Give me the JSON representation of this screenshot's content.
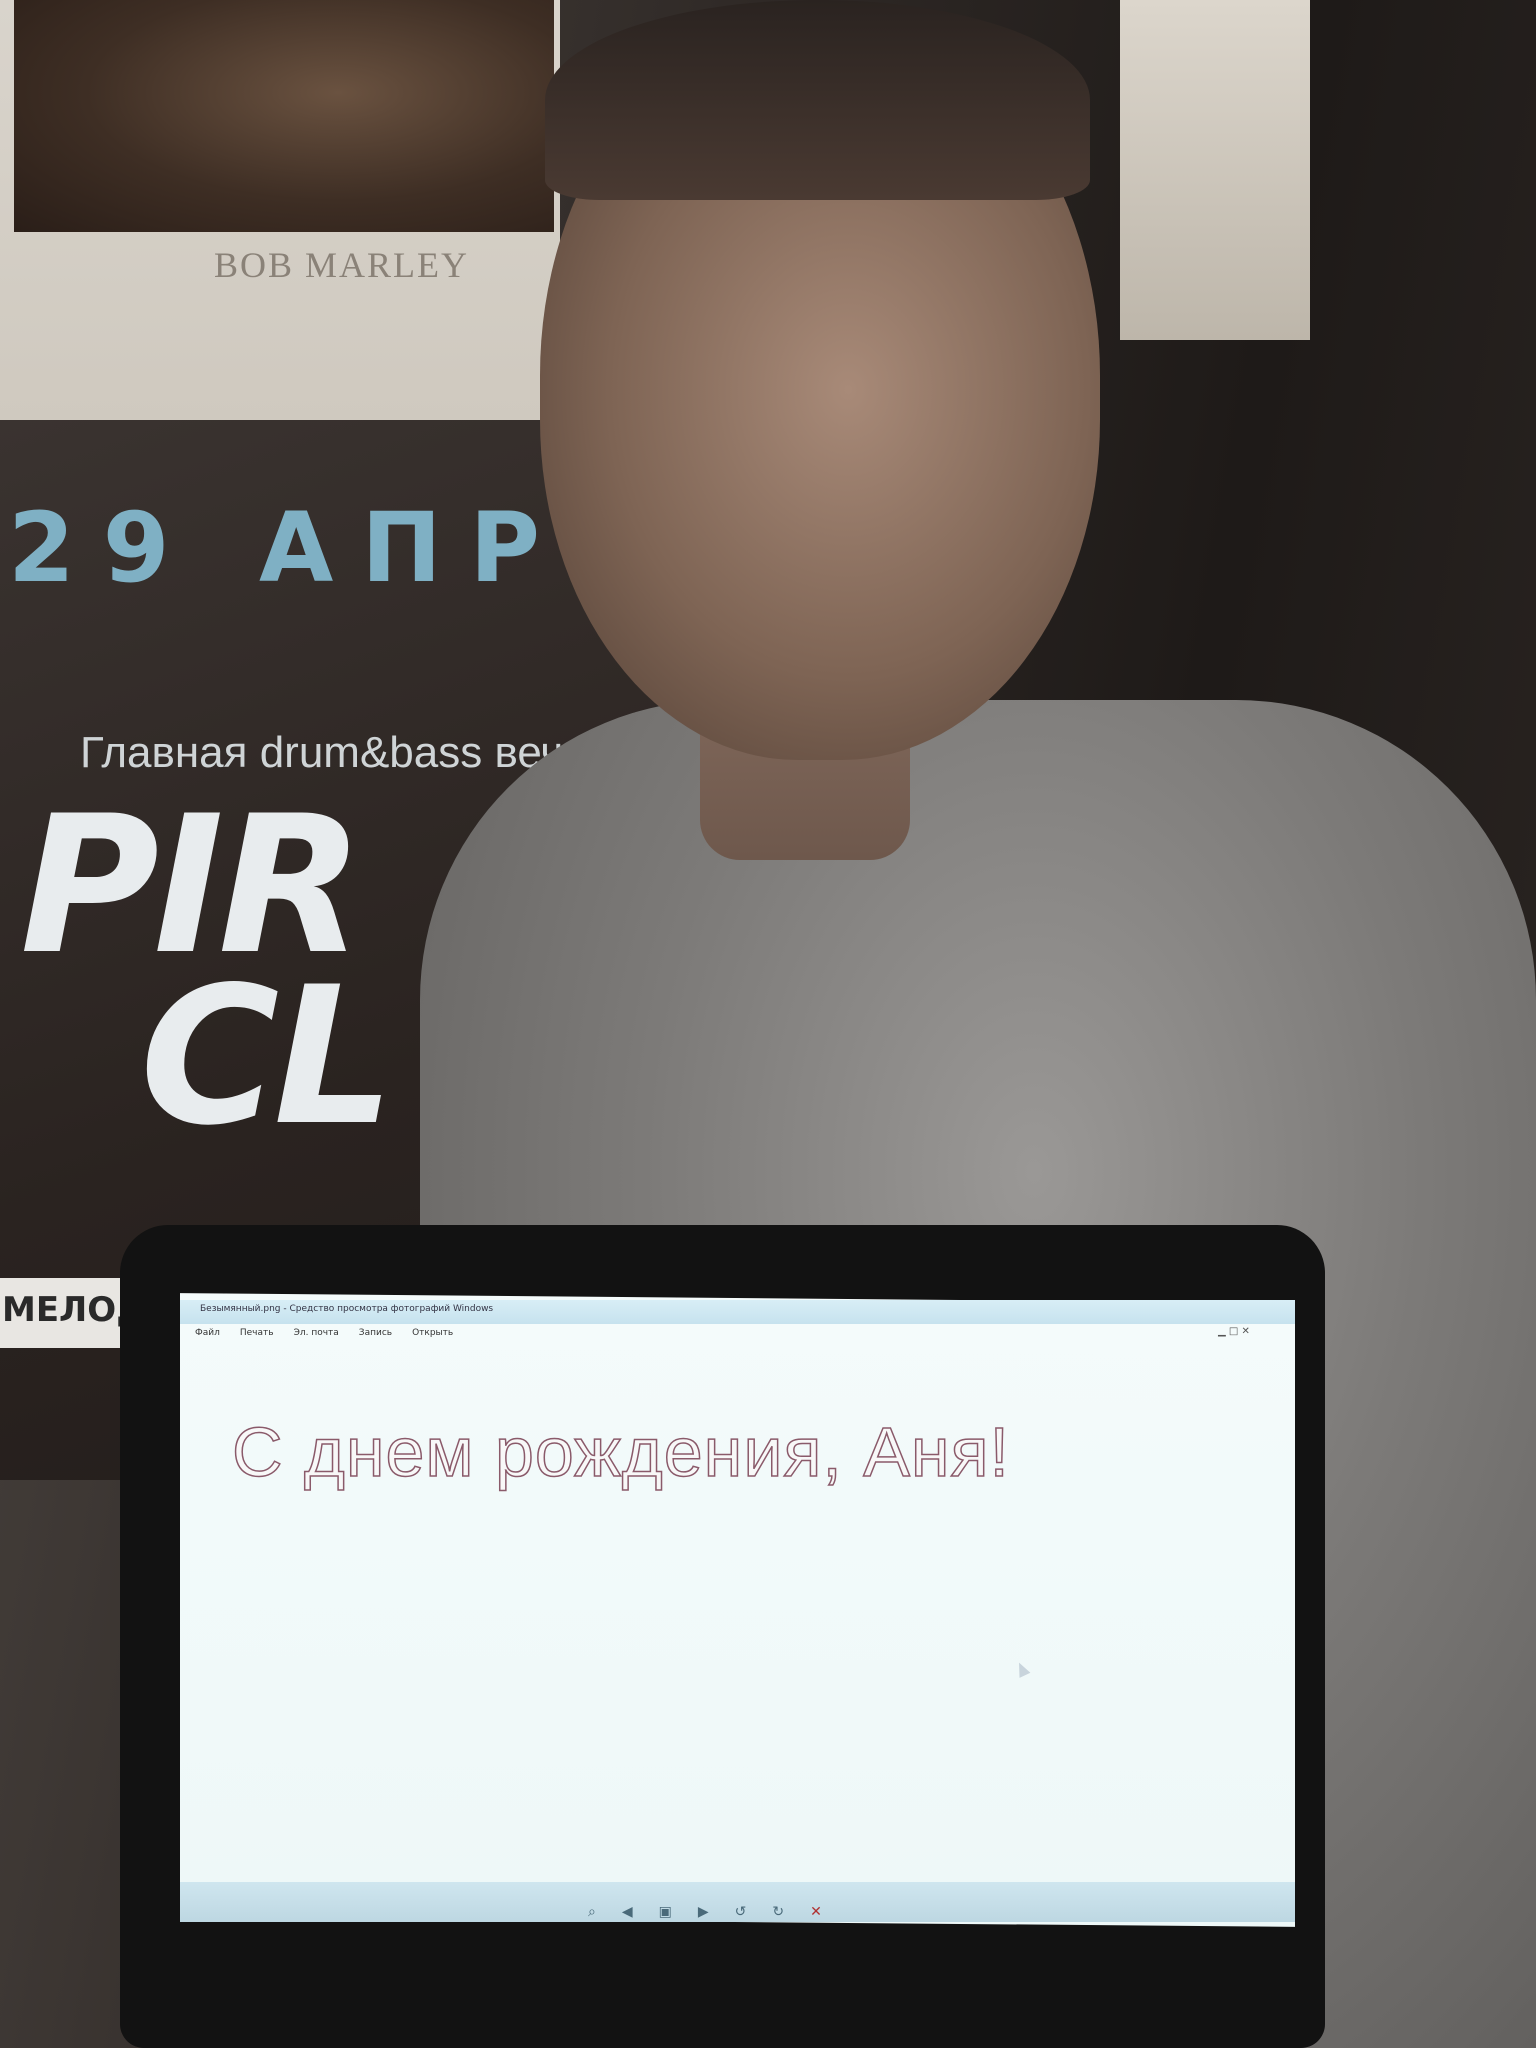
{
  "photo": {
    "poster_top": {
      "artist": "BOB MARLEY"
    },
    "poster_event": {
      "date": "29 АПР",
      "tagline": "Главная drum&bass вечер",
      "logo_line1": "PIR",
      "logo_line2": "CL",
      "shop": "МЕЛОД"
    }
  },
  "laptop_screen": {
    "window_title": "Безымянный.png - Средство просмотра фотографий Windows",
    "menu": [
      "Файл",
      "Печать",
      "Эл. почта",
      "Запись",
      "Открыть"
    ],
    "greeting": "С днем рождения, Аня!",
    "toolbar_icons": [
      "zoom-icon",
      "prev-icon",
      "slideshow-icon",
      "next-icon",
      "rotate-left-icon",
      "rotate-right-icon",
      "delete-icon"
    ]
  }
}
